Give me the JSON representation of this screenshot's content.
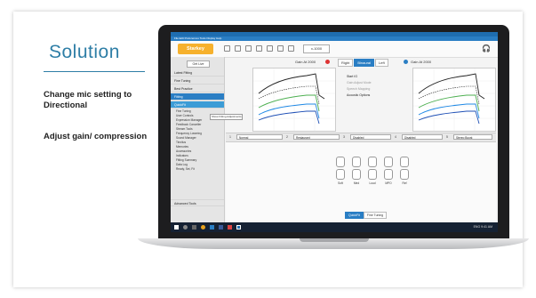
{
  "slide": {
    "title": "Solution",
    "bullets": [
      "Change mic setting to Directional",
      "Adjust gain/ compression"
    ]
  },
  "app": {
    "window_title": "Inspire · Starkey Hearing",
    "menu": "File   Edit   Preferences   Tools   Display   Help",
    "logo": "Starkey",
    "zoom_value": "x-1000",
    "brand_color": "#2a7ec4",
    "left_panel": {
      "go_button": "Get Live",
      "items": [
        "Latest Fitting",
        "Fine Tuning",
        "Best Practice",
        "Fitting"
      ],
      "sub_items": [
        "Fine Tuning",
        "User Controls",
        "Expression Manager",
        "Feedback Canceller",
        "Stream Tools",
        "Frequency Lowering",
        "Sound Manager",
        "Tinnitus",
        "Memories",
        "Accessories",
        "Indicators",
        "Fitting Summary",
        "Data Log",
        "Ready, Set, Fit"
      ],
      "selected": "QuickFit",
      "bottom": "Advanced Tools",
      "tooltip": "Show Fitting Adjustments"
    },
    "toolbar_row": {
      "left_label": "Gain At 2000",
      "right_label": "Gain At 2000",
      "tabs": [
        "Right",
        "Binaural",
        "Left"
      ],
      "active_tab": "Binaural"
    },
    "options": [
      {
        "label": "Start IG",
        "dim": false
      },
      {
        "label": "Gain Adjust Mode",
        "dim": true
      },
      {
        "label": "Speech Mapping",
        "dim": true
      },
      {
        "label": "Acoustic Options",
        "dim": false
      }
    ],
    "program_row": {
      "selects": [
        "Normal",
        "Restaurant",
        "Disabled",
        "Disabled",
        "Stereo Boost"
      ],
      "numbers": [
        "1",
        "2",
        "3",
        "4",
        "5"
      ]
    },
    "controls": {
      "labels": [
        "Soft",
        "Med",
        "Loud",
        "MPO",
        "Ref"
      ],
      "tabs": [
        "QuickFit",
        "Fine Tuning"
      ],
      "active_tab": "QuickFit"
    },
    "taskbar": {
      "tray_text": "ENG  9:41 AM"
    },
    "icons": [
      "save-icon",
      "print-icon",
      "folder-icon",
      "home-icon",
      "undo-icon",
      "headset-icon"
    ]
  }
}
